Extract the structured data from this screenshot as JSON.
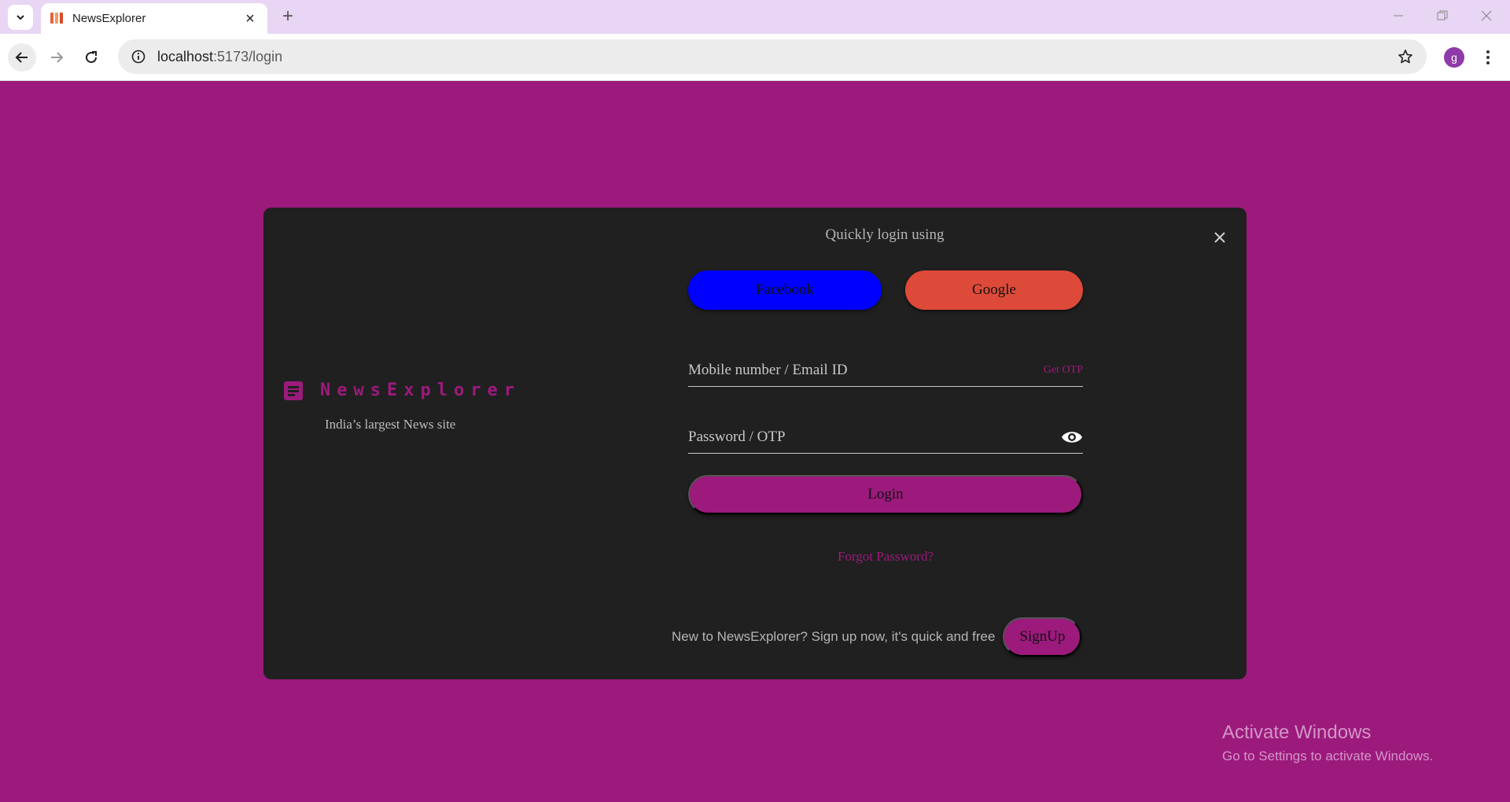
{
  "browser": {
    "tab_title": "NewsExplorer",
    "new_tab_symbol": "+",
    "tab_close_symbol": "×",
    "url_host": "localhost",
    "url_path": ":5173/login",
    "profile_initial": "g",
    "icons": {
      "tab_search": "chevron-down-icon",
      "back": "arrow-left-icon",
      "forward": "arrow-right-icon",
      "reload": "reload-icon",
      "site_info": "info-icon",
      "bookmark": "star-icon",
      "menu": "kebab-menu-icon",
      "minimize": "minimize-icon",
      "restore": "restore-icon",
      "close": "close-icon"
    }
  },
  "brand": {
    "name": "NewsExplorer",
    "tagline": "India’s largest News site",
    "icon": "article-icon",
    "color": "#9c1a7c"
  },
  "login": {
    "quick_login_title": "Quickly login using",
    "facebook_label": "Facebook",
    "google_label": "Google",
    "mobile_label": "Mobile number / Email ID",
    "get_otp_label": "Get OTP",
    "password_label": "Password / OTP",
    "login_label": "Login",
    "forgot_label": "Forgot Password?",
    "signup_prompt": "New to NewsExplorer? Sign up now, it's quick and free",
    "signup_label": "SignUp"
  },
  "colors": {
    "background": "#9c1a7c",
    "modal": "#202020",
    "facebook": "#0000ff",
    "google": "#de4a39",
    "accent": "#9c1a7c"
  },
  "watermark": {
    "title": "Activate Windows",
    "subtitle": "Go to Settings to activate Windows."
  }
}
